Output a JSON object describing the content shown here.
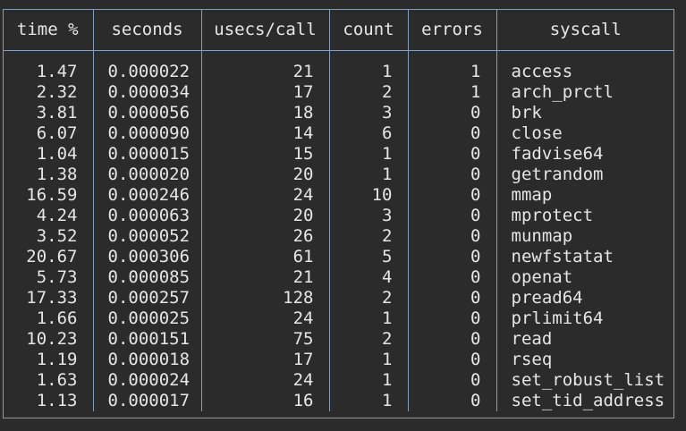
{
  "table": {
    "headers": [
      "time %",
      "seconds",
      "usecs/call",
      "count",
      "errors",
      "syscall"
    ],
    "rows": [
      [
        "1.47",
        "0.000022",
        "21",
        "1",
        "1",
        "access"
      ],
      [
        "2.32",
        "0.000034",
        "17",
        "2",
        "1",
        "arch_prctl"
      ],
      [
        "3.81",
        "0.000056",
        "18",
        "3",
        "0",
        "brk"
      ],
      [
        "6.07",
        "0.000090",
        "14",
        "6",
        "0",
        "close"
      ],
      [
        "1.04",
        "0.000015",
        "15",
        "1",
        "0",
        "fadvise64"
      ],
      [
        "1.38",
        "0.000020",
        "20",
        "1",
        "0",
        "getrandom"
      ],
      [
        "16.59",
        "0.000246",
        "24",
        "10",
        "0",
        "mmap"
      ],
      [
        "4.24",
        "0.000063",
        "20",
        "3",
        "0",
        "mprotect"
      ],
      [
        "3.52",
        "0.000052",
        "26",
        "2",
        "0",
        "munmap"
      ],
      [
        "20.67",
        "0.000306",
        "61",
        "5",
        "0",
        "newfstatat"
      ],
      [
        "5.73",
        "0.000085",
        "21",
        "4",
        "0",
        "openat"
      ],
      [
        "17.33",
        "0.000257",
        "128",
        "2",
        "0",
        "pread64"
      ],
      [
        "1.66",
        "0.000025",
        "24",
        "1",
        "0",
        "prlimit64"
      ],
      [
        "10.23",
        "0.000151",
        "75",
        "2",
        "0",
        "read"
      ],
      [
        "1.19",
        "0.000018",
        "17",
        "1",
        "0",
        "rseq"
      ],
      [
        "1.63",
        "0.000024",
        "24",
        "1",
        "0",
        "set_robust_list"
      ],
      [
        "1.13",
        "0.000017",
        "16",
        "1",
        "0",
        "set_tid_address"
      ]
    ]
  }
}
